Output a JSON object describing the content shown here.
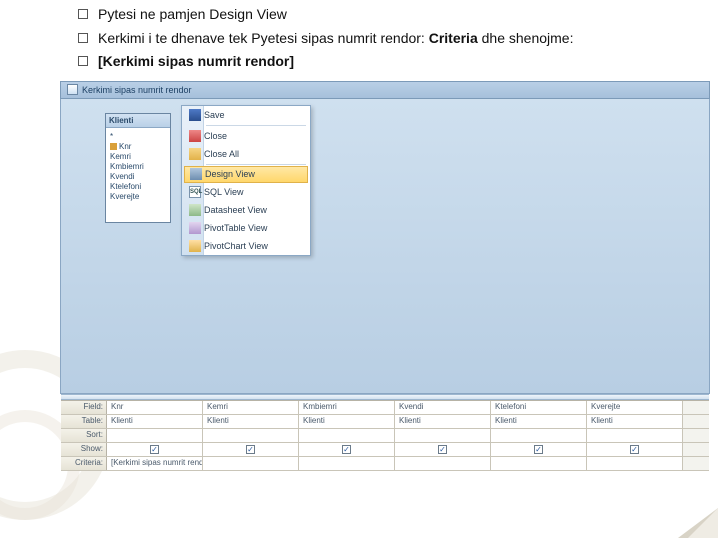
{
  "bullets": {
    "b1": "Pytesi ne pamjen Design View",
    "b2a": "Kerkimi i te dhenave tek Pyetesi sipas numrit rendor: ",
    "b2b": "Criteria",
    "b2c": " dhe shenojme:",
    "b3": "[Kerkimi sipas numrit rendor]"
  },
  "titlebar": {
    "text": "Kerkimi sipas numrit rendor"
  },
  "fieldlist": {
    "title": "Klienti",
    "star": "*",
    "items": [
      "Knr",
      "Kemri",
      "Kmbiemri",
      "Kvendi",
      "Ktelefoni",
      "Kverejte"
    ]
  },
  "menu": {
    "items": [
      {
        "label": "Save",
        "icon": "ic-save"
      },
      {
        "label": "Close",
        "icon": "ic-close"
      },
      {
        "label": "Close All",
        "icon": "ic-folder"
      },
      {
        "label": "Design View",
        "icon": "ic-design",
        "selected": true
      },
      {
        "label": "SQL View",
        "icon": "ic-sql",
        "text": "SQL"
      },
      {
        "label": "Datasheet View",
        "icon": "ic-data"
      },
      {
        "label": "PivotTable View",
        "icon": "ic-pivot"
      },
      {
        "label": "PivotChart View",
        "icon": "ic-chart"
      }
    ]
  },
  "grid": {
    "labels": [
      "Field:",
      "Table:",
      "Sort:",
      "Show:",
      "Criteria:"
    ],
    "cols": [
      {
        "field": "Knr",
        "table": "Klienti",
        "criteria": "[Kerkimi sipas numrit rendor]"
      },
      {
        "field": "Kemri",
        "table": "Klienti",
        "criteria": ""
      },
      {
        "field": "Kmbiemri",
        "table": "Klienti",
        "criteria": ""
      },
      {
        "field": "Kvendi",
        "table": "Klienti",
        "criteria": ""
      },
      {
        "field": "Ktelefoni",
        "table": "Klienti",
        "criteria": ""
      },
      {
        "field": "Kverejte",
        "table": "Klienti",
        "criteria": ""
      }
    ]
  }
}
